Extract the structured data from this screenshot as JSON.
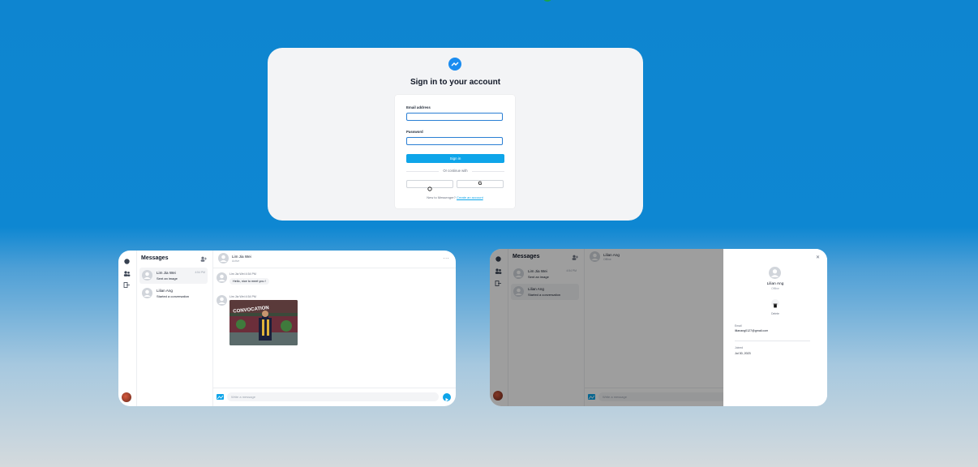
{
  "login": {
    "title": "Sign in to your account",
    "email_label": "Email address",
    "email_value": "",
    "password_label": "Password",
    "password_value": "",
    "signin_label": "Sign in",
    "divider_text": "Or continue with",
    "github_icon": "github-icon",
    "google_label": "G",
    "new_text": "New to Messenger?",
    "create_link": "Create an account"
  },
  "chat": {
    "sidebar_title": "Messages",
    "conversations": [
      {
        "name": "Lim Jia Wei",
        "preview": "Sent an image",
        "time": "4:54 PM"
      },
      {
        "name": "Lilian Ang",
        "preview": "Started a conversation",
        "time": ""
      }
    ],
    "header": {
      "name": "Lim Jia Wei",
      "status": "Active",
      "more": "..."
    },
    "messages": [
      {
        "sender": "Lim Jia Wei",
        "time": "4:54 PM",
        "text": "Hello, nice to meet you !"
      },
      {
        "sender": "Lim Jia Wei",
        "time": "4:54 PM",
        "image_text": "CONVOCATION"
      }
    ],
    "input_placeholder": "Write a message"
  },
  "chat2": {
    "sidebar_title": "Messages",
    "conversations": [
      {
        "name": "Lim Jia Wei",
        "preview": "Sent an image",
        "time": "4:54 PM"
      },
      {
        "name": "Lilian Ang",
        "preview": "Started a conversation",
        "time": ""
      }
    ],
    "header": {
      "name": "Lilian Ang",
      "status": "Offline"
    },
    "input_placeholder": "Write a message"
  },
  "profile": {
    "name": "Lilian Ang",
    "status": "Offline",
    "delete_label": "Delete",
    "email_label": "Email",
    "email_value": "lilianang0127@gmail.com",
    "joined_label": "Joined",
    "joined_value": "Jul 30, 2023"
  },
  "colors": {
    "accent": "#0ea5e9",
    "background": "#0e85d0"
  }
}
